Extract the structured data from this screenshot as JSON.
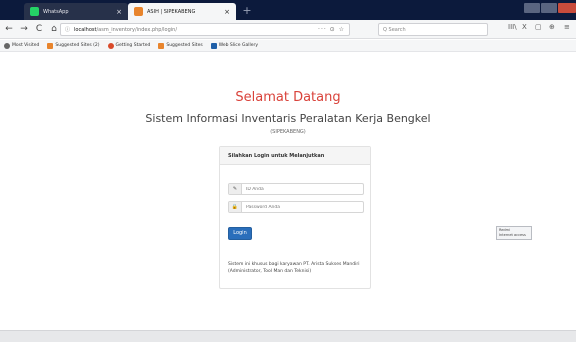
{
  "browser": {
    "tabs": [
      {
        "label": "WhatsApp",
        "close": "×",
        "favicon_color": "#25d366",
        "active": false
      },
      {
        "label": "ASIH | SIPEKABENG",
        "close": "×",
        "favicon_color": "#e8842c",
        "active": true
      }
    ],
    "new_tab": "+",
    "nav": {
      "back": "←",
      "forward": "→",
      "reload": "C",
      "home": "⌂"
    },
    "url": {
      "host": "localhost",
      "path": "/asm_inventory/index.php/login/",
      "tail": "··· ⊙ ☆"
    },
    "search_placeholder": "Q Search",
    "toolbar_right": [
      "III\\",
      "X",
      "▢",
      "⊕",
      "≡"
    ],
    "bookmarks": [
      {
        "label": "Most Visited",
        "icon_color": "#666666"
      },
      {
        "label": "Suggested Sites (2)",
        "icon_color": "#e8842c"
      },
      {
        "label": "Getting Started",
        "icon_color": "#d94a2a"
      },
      {
        "label": "Suggested Sites",
        "icon_color": "#e8842c"
      },
      {
        "label": "Web Slice Gallery",
        "icon_color": "#1f5fa8"
      }
    ]
  },
  "page": {
    "welcome": "Selamat Datang",
    "system_title": "Sistem Informasi Inventaris Peralatan Kerja Bengkel",
    "system_subtitle": "(SIPEKABENG)",
    "panel_heading": "Silahkan Login untuk Melanjutkan",
    "id_field": {
      "icon": "✎",
      "placeholder": "ID Anda"
    },
    "password_field": {
      "icon": "🔒",
      "placeholder": "Password Anda"
    },
    "login_label": "Login",
    "note": "Sistem ini khusus bagi karyawan PT. Arista Sukses Mandiri (Administrator, Tool Man dan Teknisi)",
    "badge": {
      "line1": "Redmi",
      "line2": "Internet access"
    }
  },
  "colors": {
    "accent_red": "#d9423a",
    "button_blue": "#2a6ebb",
    "titlebar": "#0c1a3c"
  }
}
